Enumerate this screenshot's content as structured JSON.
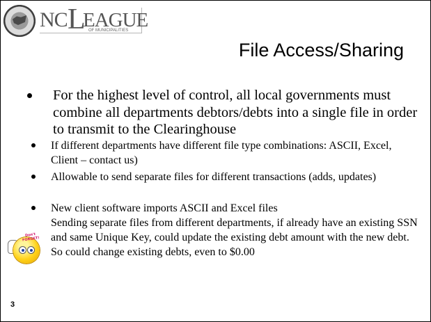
{
  "logo": {
    "nc": "NC",
    "l": "L",
    "rest": "EAGUE",
    "sub": "OF MUNICIPALITIES"
  },
  "title": "File Access/Sharing",
  "bullets": [
    "For the highest level of control, all local governments must combine all departments debtors/debts into a single file in order to transmit to the Clearinghouse",
    "If different departments have different file type combinations: ASCII, Excel, Client – contact us)",
    "Allowable to send separate files for different transactions (adds, updates)",
    "New client software imports ASCII and Excel files",
    "Sending separate files from different departments, if already have an existing SSN and same Unique Key, could update the existing debt amount with the new debt. So could change existing debts, even  to $0.00"
  ],
  "sticker": {
    "text": "Don't FORGET!"
  },
  "page_number": "3"
}
